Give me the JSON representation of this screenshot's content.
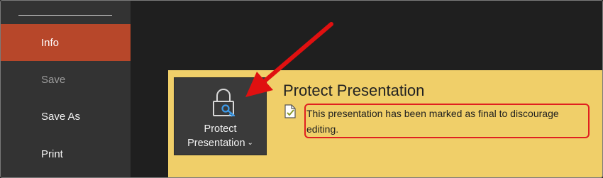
{
  "sidebar": {
    "items": [
      {
        "label": "Info",
        "state": "active"
      },
      {
        "label": "Save",
        "state": "disabled"
      },
      {
        "label": "Save As",
        "state": "normal"
      },
      {
        "label": "Print",
        "state": "normal"
      }
    ]
  },
  "protect": {
    "button_label": "Protect Presentation",
    "button_icon": "lock-key-icon",
    "section_title": "Protect Presentation",
    "status_icon": "document-check-icon",
    "status_text": "This presentation has been marked as final to discourage editing."
  },
  "colors": {
    "active_nav": "#b7472a",
    "banner": "#f0cf69",
    "callout": "#e02020"
  }
}
